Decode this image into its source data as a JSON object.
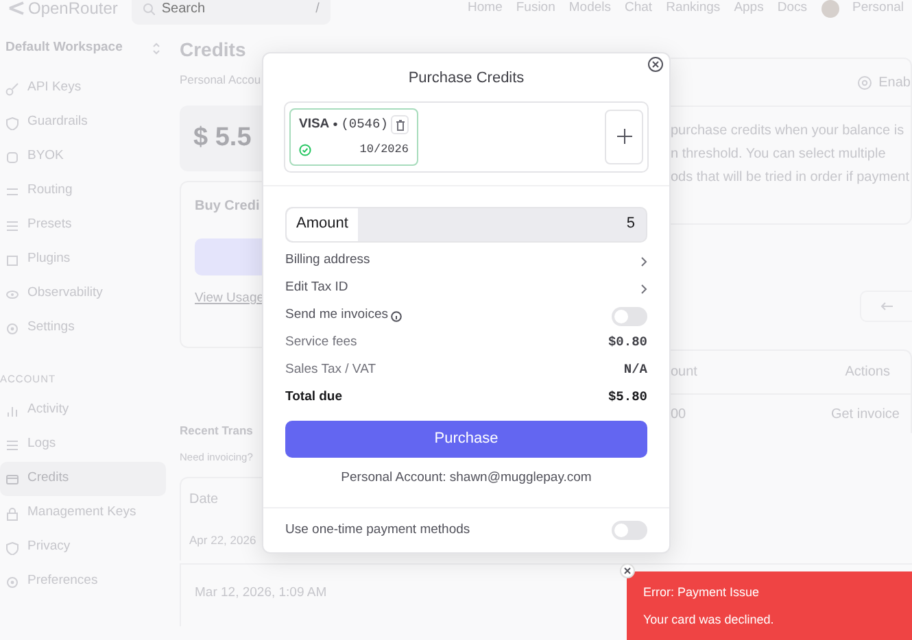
{
  "nav": {
    "logo": "OpenRouter",
    "search": {
      "placeholder": "Search",
      "shortcut": "/"
    },
    "links": [
      "Home",
      "Fusion",
      "Models",
      "Chat",
      "Rankings",
      "Apps",
      "Docs"
    ],
    "account": "Personal"
  },
  "sidebar": {
    "workspace": "Default Workspace",
    "items": [
      {
        "label": "API Keys",
        "selected": false
      },
      {
        "label": "Guardrails",
        "selected": false
      },
      {
        "label": "BYOK",
        "selected": false
      },
      {
        "label": "Routing",
        "selected": false
      },
      {
        "label": "Presets",
        "selected": false
      },
      {
        "label": "Plugins",
        "selected": false
      },
      {
        "label": "Observability",
        "selected": false
      },
      {
        "label": "Settings",
        "selected": false
      }
    ],
    "section": "ACCOUNT",
    "account_items": [
      {
        "label": "Activity",
        "selected": false
      },
      {
        "label": "Logs",
        "selected": false
      },
      {
        "label": "Credits",
        "selected": true
      },
      {
        "label": "Management Keys",
        "selected": false
      },
      {
        "label": "Privacy",
        "selected": false
      },
      {
        "label": "Preferences",
        "selected": false
      }
    ]
  },
  "page": {
    "title": "Credits",
    "subtitle": "Personal Accou",
    "balance": "$ 5.5",
    "buy_card": {
      "title": "Buy Credi",
      "link": "View Usage"
    },
    "auto_topup": {
      "action": "Enab",
      "text": "purchase credits when your balance is\nn threshold. You can select multiple\nods that will be tried in order if payment"
    },
    "transactions": {
      "title": "Recent Trans",
      "note": "Need invoicing?",
      "columns": [
        "Date",
        "ount",
        "Actions"
      ],
      "rows": [
        {
          "date": "Apr 22, 2026",
          "amount": "00",
          "action": "Get invoice"
        },
        {
          "date": "Mar 12, 2026, 1:09 AM"
        }
      ]
    }
  },
  "modal": {
    "title": "Purchase Credits",
    "cards": [
      {
        "brand": "VISA",
        "separator": "•",
        "number": "(0546)",
        "expiry": "10/2026",
        "selected": true
      }
    ],
    "amount": {
      "label": "Amount",
      "value": "5"
    },
    "links": [
      "Billing address",
      "Edit Tax ID"
    ],
    "invoices": {
      "label": "Send me invoices",
      "on": false
    },
    "fees": [
      {
        "label": "Service fees",
        "value": "$0.80",
        "kind": "fee"
      },
      {
        "label": "Sales Tax / VAT",
        "value": "N/A",
        "kind": "fee"
      },
      {
        "label": "Total due",
        "value": "$5.80",
        "kind": "total"
      }
    ],
    "button": "Purchase",
    "account_note": "Personal Account: shawn@mugglepay.com",
    "one_time": {
      "label": "Use one-time payment methods",
      "on": false
    }
  },
  "toast": {
    "title": "Error: Payment Issue",
    "message": "Your card was declined."
  }
}
